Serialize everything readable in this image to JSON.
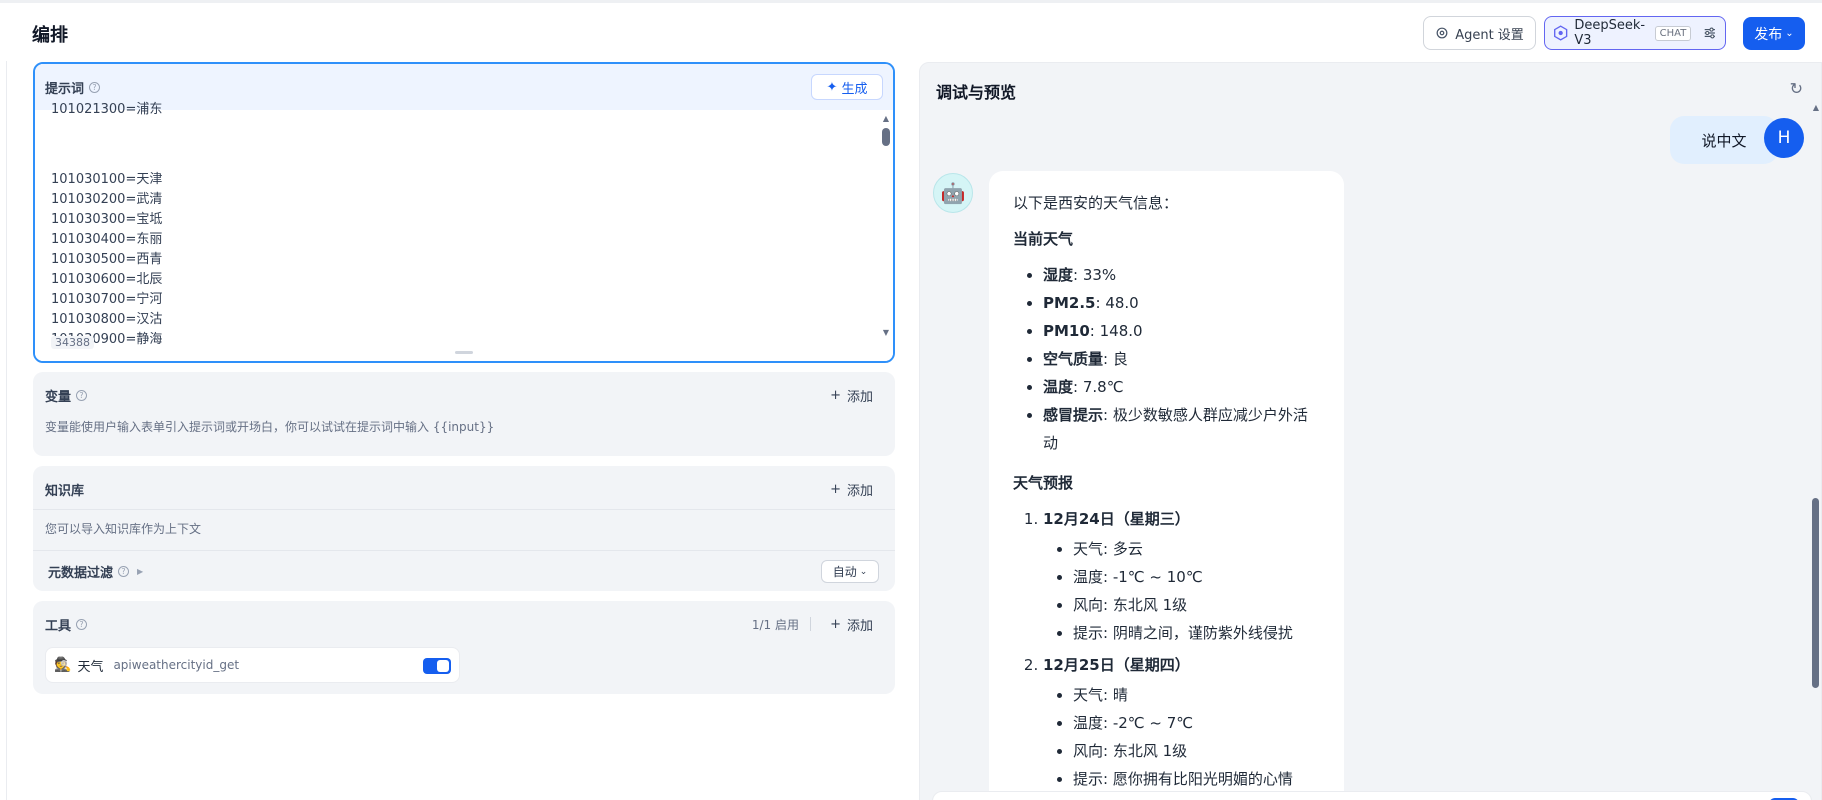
{
  "header": {
    "title": "编排",
    "agent_settings_label": "Agent 设置",
    "model_name": "DeepSeek-V3",
    "model_badge": "CHAT",
    "publish_label": "发布"
  },
  "prompt": {
    "label": "提示词",
    "generate_label": "生成",
    "partial_line": "101021300=浦东",
    "lines": [
      "101030100=天津",
      "101030200=武清",
      "101030300=宝坻",
      "101030400=东丽",
      "101030500=西青",
      "101030600=北辰",
      "101030700=宁河",
      "101030800=汉沽",
      "101030900=静海"
    ],
    "char_count": "34388"
  },
  "variables": {
    "label": "变量",
    "add_label": "添加",
    "description": "变量能使用户输入表单引入提示词或开场白，你可以试试在提示词中输入 {{input}}"
  },
  "knowledge": {
    "label": "知识库",
    "add_label": "添加",
    "description": "您可以导入知识库作为上下文",
    "metadata_filter_label": "元数据过滤",
    "metadata_mode": "自动"
  },
  "tools": {
    "label": "工具",
    "enabled_count": "1/1 启用",
    "add_label": "添加",
    "items": [
      {
        "name": "天气",
        "id": "apiweathercityid_get",
        "enabled": true
      }
    ]
  },
  "preview": {
    "title": "调试与预览",
    "user_avatar_letter": "H",
    "user_message": "说中文",
    "answer": {
      "intro": "以下是西安的天气信息：",
      "current_heading": "当前天气",
      "current": [
        {
          "key": "湿度",
          "value": ": 33%"
        },
        {
          "key": "PM2.5",
          "value": ": 48.0"
        },
        {
          "key": "PM10",
          "value": ": 148.0"
        },
        {
          "key": "空气质量",
          "value": ": 良"
        },
        {
          "key": "温度",
          "value": ": 7.8℃"
        },
        {
          "key": "感冒提示",
          "value": ": 极少数敏感人群应减少户外活动"
        }
      ],
      "forecast_heading": "天气预报",
      "forecast": [
        {
          "date": "12月24日（星期三）",
          "items": [
            "天气: 多云",
            "温度: -1℃ ~ 10℃",
            "风向: 东北风 1级",
            "提示: 阴晴之间，谨防紫外线侵扰"
          ]
        },
        {
          "date": "12月25日（星期四）",
          "items": [
            "天气: 晴",
            "温度: -2℃ ~ 7℃",
            "风向: 东北风 1级",
            "提示: 愿你拥有比阳光明媚的心情"
          ]
        }
      ]
    }
  },
  "colors": {
    "primary": "#155eef",
    "prompt_border": "#2e90fa",
    "panel_bg": "#f2f4f7"
  }
}
